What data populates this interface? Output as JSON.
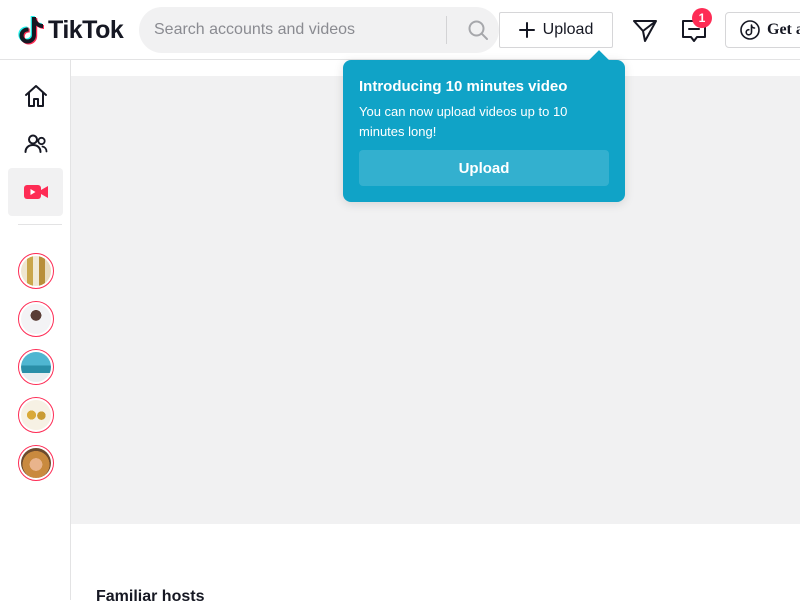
{
  "header": {
    "logo_text": "TikTok",
    "search_placeholder": "Search accounts and videos",
    "upload_label": "Upload",
    "inbox_badge": "1",
    "get_app_label": "Get a"
  },
  "sidebar": {
    "items": [
      {
        "name": "home",
        "icon": "home-icon"
      },
      {
        "name": "following",
        "icon": "users-icon"
      },
      {
        "name": "live",
        "icon": "live-camera-icon",
        "active": true
      }
    ],
    "avatars_count": 5
  },
  "tooltip": {
    "title": "Introducing 10 minutes video",
    "body": "You can now upload videos up to 10 minutes long!",
    "button_label": "Upload"
  },
  "main": {
    "section_title": "Familiar hosts"
  },
  "colors": {
    "accent": "#fe2c55",
    "tooltip_bg": "#10a3c7",
    "placeholder_bg": "#f1f1f2"
  }
}
